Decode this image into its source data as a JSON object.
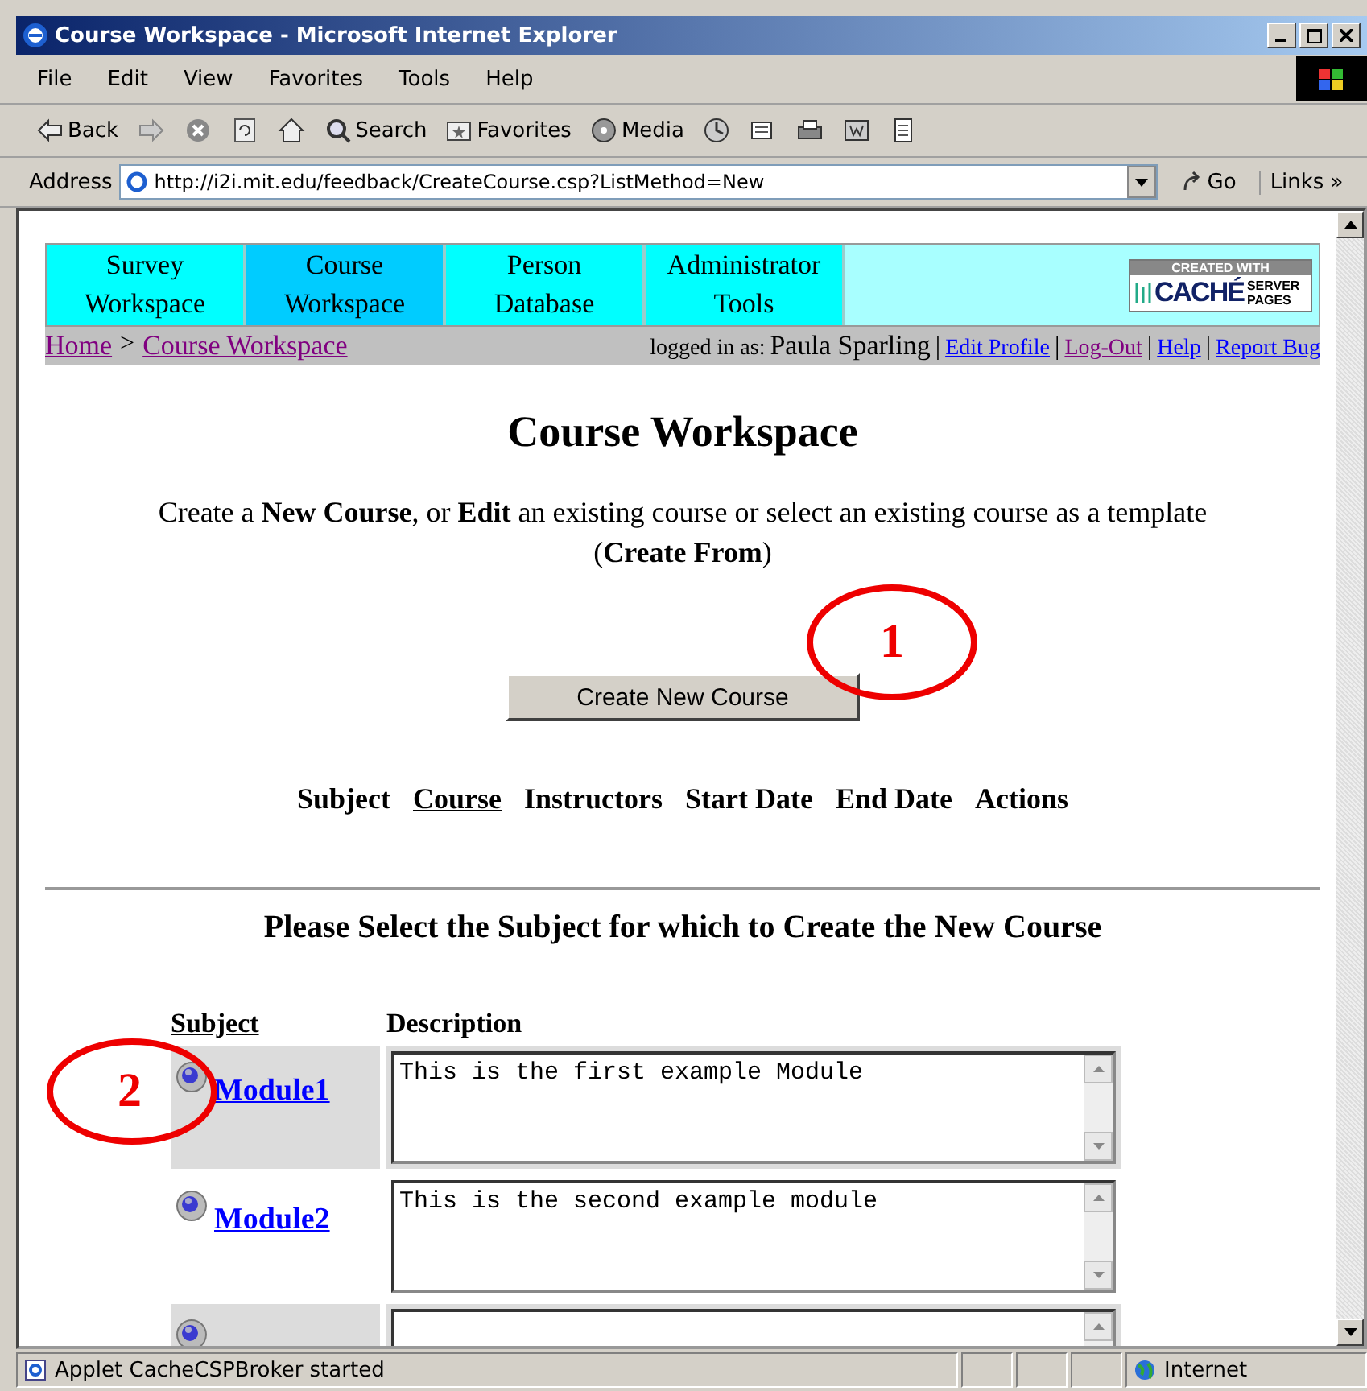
{
  "window": {
    "title": "Course Workspace - Microsoft Internet Explorer"
  },
  "menu": [
    "File",
    "Edit",
    "View",
    "Favorites",
    "Tools",
    "Help"
  ],
  "toolbar": [
    {
      "kind": "back",
      "label": "Back"
    },
    {
      "kind": "forward"
    },
    {
      "kind": "stop"
    },
    {
      "kind": "refresh"
    },
    {
      "kind": "home"
    },
    {
      "kind": "search",
      "label": "Search"
    },
    {
      "kind": "favorites",
      "label": "Favorites"
    },
    {
      "kind": "media",
      "label": "Media"
    },
    {
      "kind": "history"
    },
    {
      "kind": "mail"
    },
    {
      "kind": "print"
    },
    {
      "kind": "edit"
    },
    {
      "kind": "discuss"
    }
  ],
  "address": {
    "label": "Address",
    "value": "http://i2i.mit.edu/feedback/CreateCourse.csp?ListMethod=New",
    "go": "Go",
    "links": "Links",
    "more": "»"
  },
  "nav_tabs": [
    {
      "line1": "Survey",
      "line2": "Workspace",
      "selected": false
    },
    {
      "line1": "Course",
      "line2": "Workspace",
      "selected": true
    },
    {
      "line1": "Person",
      "line2": "Database",
      "selected": false
    },
    {
      "line1": "Administrator",
      "line2": "Tools",
      "selected": false
    }
  ],
  "logo": {
    "top": "CREATED WITH",
    "brand": "CACHÉ",
    "side1": "SERVER",
    "side2": "PAGES"
  },
  "breadcrumb": [
    {
      "label": "Home"
    },
    {
      "label": "Course Workspace"
    }
  ],
  "breadcrumb_separator": ">",
  "login": {
    "prefix": "logged in as:",
    "user": "Paula Sparling"
  },
  "user_links_separator": "|",
  "user_links": [
    {
      "label": "Edit Profile",
      "visited": false
    },
    {
      "label": "Log-Out",
      "visited": true
    },
    {
      "label": "Help",
      "visited": false
    },
    {
      "label": "Report Bug",
      "visited": false
    }
  ],
  "heading": "Course Workspace",
  "intro": "Create a **New Course**, or **Edit** an existing course or select an existing course as a template (**Create From**)",
  "create_button": "Create New Course",
  "course_columns": [
    {
      "label": "Subject",
      "sorted": false
    },
    {
      "label": "Course",
      "sorted": true
    },
    {
      "label": "Instructors",
      "sorted": false
    },
    {
      "label": "Start Date",
      "sorted": false
    },
    {
      "label": "End Date",
      "sorted": false
    },
    {
      "label": "Actions",
      "sorted": false
    }
  ],
  "subject_heading": "Please Select the Subject for which to Create the New Course",
  "subject_table": {
    "columns": [
      "Subject",
      "Description"
    ],
    "rows": [
      {
        "name": "Module1",
        "description": "This is the first example Module",
        "shaded": true
      },
      {
        "name": "Module2",
        "description": "This is the second example module",
        "shaded": false
      },
      {
        "shaded": true
      }
    ]
  },
  "callouts": [
    {
      "number": "1"
    },
    {
      "number": "2"
    }
  ],
  "status_bar": {
    "text": "Applet CacheCSPBroker started",
    "zone": "Internet"
  }
}
